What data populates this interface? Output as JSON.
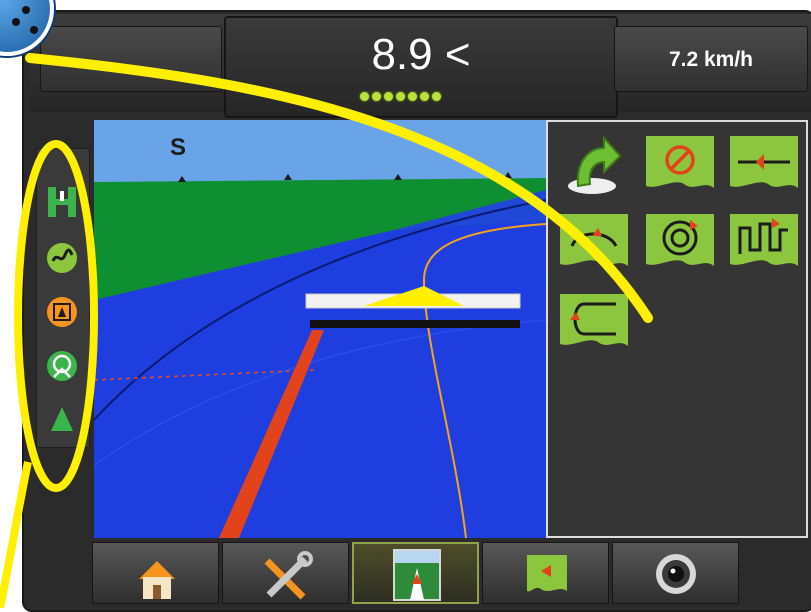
{
  "status_bar": {
    "cross_track_value": "8.9 <",
    "speed": "7.2 km/h",
    "guidance_leds_lit": 7
  },
  "map": {
    "compass_heading": "S"
  },
  "sidebar": {
    "items": [
      {
        "icon": "straight-ab-line-icon"
      },
      {
        "icon": "guidance-mode-icon"
      },
      {
        "icon": "view-toggle-icon"
      },
      {
        "icon": "steering-engage-icon"
      },
      {
        "icon": "mark-point-icon"
      }
    ]
  },
  "guidance_panel": {
    "buttons": [
      {
        "icon": "back-return-icon"
      },
      {
        "icon": "cancel-guidance-icon"
      },
      {
        "icon": "straight-ab-icon"
      },
      {
        "icon": "adaptive-curve-icon"
      },
      {
        "icon": "circle-pivot-icon"
      },
      {
        "icon": "last-pass-icon"
      },
      {
        "icon": "headland-icon"
      }
    ]
  },
  "bottom_tabs": [
    {
      "icon": "home-icon",
      "active": false
    },
    {
      "icon": "tools-icon",
      "active": false
    },
    {
      "icon": "guidance-view-icon",
      "active": true
    },
    {
      "icon": "mark-guidance-icon",
      "active": false
    },
    {
      "icon": "camera-icon",
      "active": false
    }
  ],
  "colors": {
    "accent_green": "#8cc63f",
    "highlight_yellow": "#ffef00",
    "sky": "#6aa4e8",
    "field_green": "#0e8f32",
    "coverage_blue": "#1f3ee0",
    "boundary_red": "#e3431a"
  }
}
